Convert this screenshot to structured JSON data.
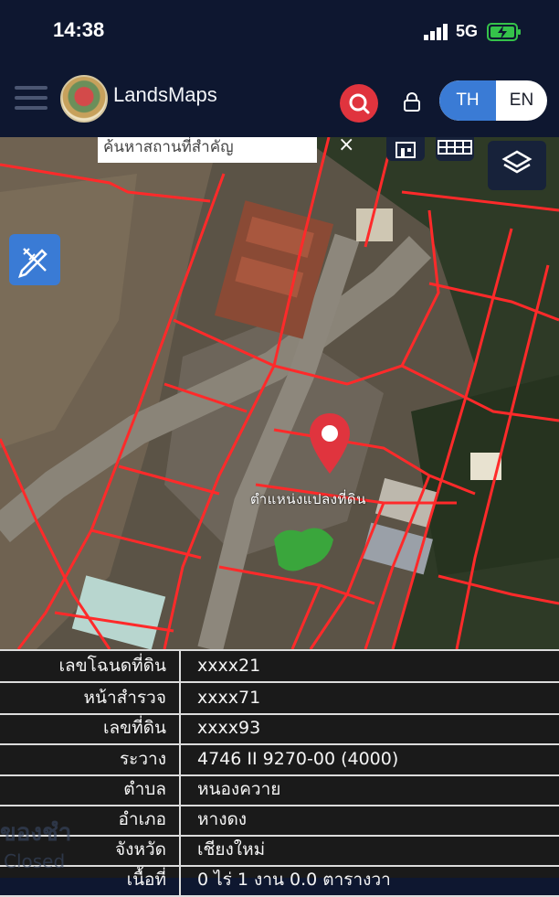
{
  "status_bar": {
    "time": "14:38",
    "network": "5G"
  },
  "header": {
    "brand": "LandsMaps",
    "lang_th": "TH",
    "lang_en": "EN"
  },
  "map": {
    "search_placeholder": "ค้นหาสถานที่สำคัญ",
    "clear_symbol": "×",
    "pin_label": "ตำแหน่งแปลงที่ดิน"
  },
  "parcel_info": {
    "rows": [
      {
        "label": "เลขโฉนดที่ดิน",
        "value": "xxxx21"
      },
      {
        "label": "หน้าสำรวจ",
        "value": "xxxx71"
      },
      {
        "label": "เลขที่ดิน",
        "value": "xxxx93"
      },
      {
        "label": "ระวาง",
        "value": "4746 II 9270-00 (4000)"
      },
      {
        "label": "ตำบล",
        "value": "หนองควาย"
      },
      {
        "label": "อำเภอ",
        "value": "หางดง"
      },
      {
        "label": "จังหวัด",
        "value": "เชียงใหม่"
      },
      {
        "label": "เนื้อที่",
        "value": "0 ไร่ 1 งาน 0.0 ตารางวา"
      }
    ]
  },
  "background_ghost": {
    "text1": "ของชำ",
    "text2": "Closed"
  },
  "colors": {
    "accent_blue": "#3a7bd5",
    "pin_red": "#e0343e",
    "parcel_line": "#ff2a2a"
  }
}
